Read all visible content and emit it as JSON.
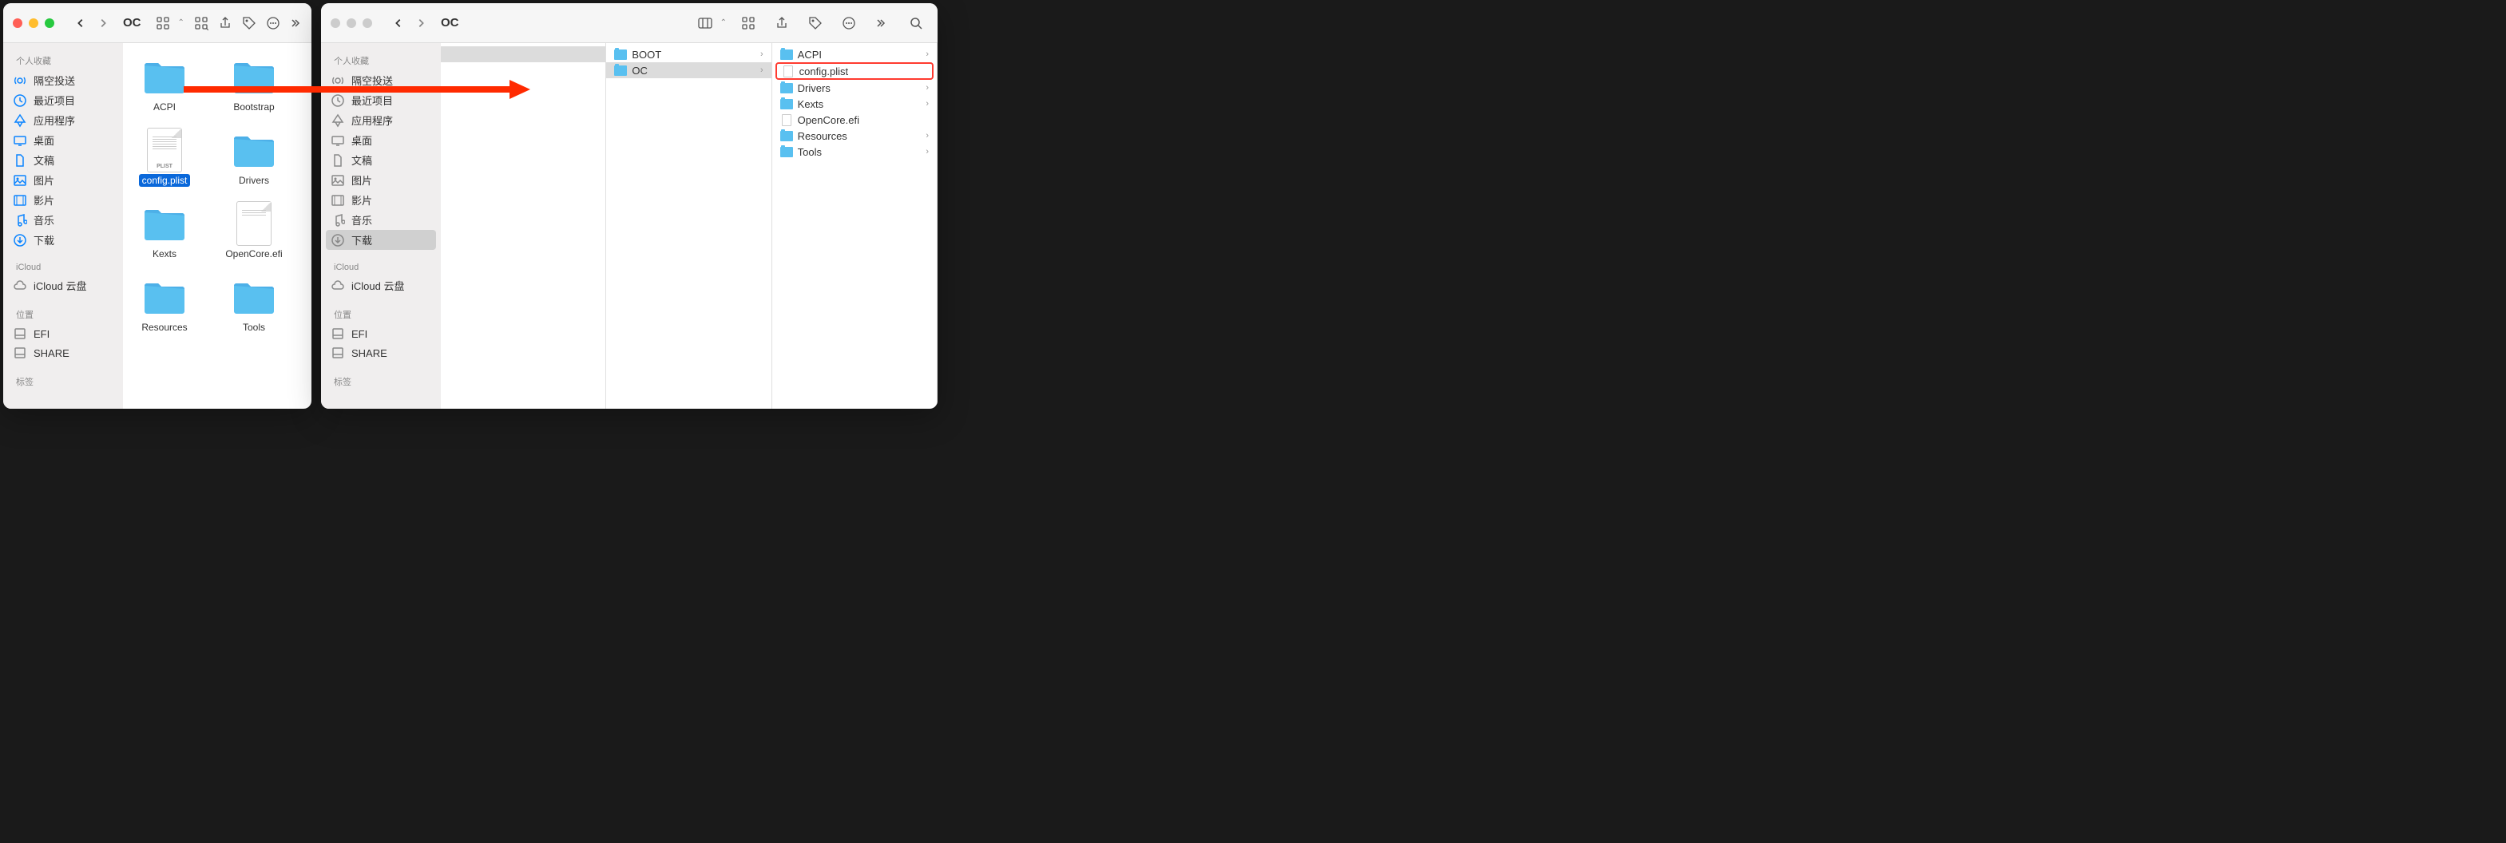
{
  "left_window": {
    "title": "OC",
    "sidebar": {
      "favorites_header": "个人收藏",
      "favorites": [
        {
          "icon": "airdrop",
          "label": "隔空投送"
        },
        {
          "icon": "clock",
          "label": "最近项目"
        },
        {
          "icon": "apps",
          "label": "应用程序"
        },
        {
          "icon": "desktop",
          "label": "桌面"
        },
        {
          "icon": "document",
          "label": "文稿"
        },
        {
          "icon": "image",
          "label": "图片"
        },
        {
          "icon": "movie",
          "label": "影片"
        },
        {
          "icon": "music",
          "label": "音乐"
        },
        {
          "icon": "download",
          "label": "下载"
        }
      ],
      "icloud_header": "iCloud",
      "icloud": [
        {
          "icon": "cloud",
          "label": "iCloud 云盘"
        }
      ],
      "locations_header": "位置",
      "locations": [
        {
          "icon": "disk",
          "label": "EFI"
        },
        {
          "icon": "disk",
          "label": "SHARE"
        }
      ],
      "tags_header": "标签"
    },
    "items": [
      {
        "name": "ACPI",
        "type": "folder"
      },
      {
        "name": "Bootstrap",
        "type": "folder"
      },
      {
        "name": "config.plist",
        "type": "plist",
        "selected": true
      },
      {
        "name": "Drivers",
        "type": "folder"
      },
      {
        "name": "Kexts",
        "type": "folder"
      },
      {
        "name": "OpenCore.efi",
        "type": "file"
      },
      {
        "name": "Resources",
        "type": "folder"
      },
      {
        "name": "Tools",
        "type": "folder"
      }
    ],
    "plist_label": "PLIST"
  },
  "right_window": {
    "title": "OC",
    "sidebar": {
      "favorites_header": "个人收藏",
      "favorites": [
        {
          "icon": "airdrop",
          "label": "隔空投送"
        },
        {
          "icon": "clock",
          "label": "最近项目"
        },
        {
          "icon": "apps",
          "label": "应用程序"
        },
        {
          "icon": "desktop",
          "label": "桌面"
        },
        {
          "icon": "document",
          "label": "文稿"
        },
        {
          "icon": "image",
          "label": "图片"
        },
        {
          "icon": "movie",
          "label": "影片"
        },
        {
          "icon": "music",
          "label": "音乐"
        },
        {
          "icon": "download",
          "label": "下载",
          "selected": true
        }
      ],
      "icloud_header": "iCloud",
      "icloud": [
        {
          "icon": "cloud",
          "label": "iCloud 云盘"
        }
      ],
      "locations_header": "位置",
      "locations": [
        {
          "icon": "disk",
          "label": "EFI"
        },
        {
          "icon": "disk",
          "label": "SHARE"
        }
      ],
      "tags_header": "标签"
    },
    "columns": [
      {
        "items": [
          {
            "name": "",
            "type": "blank",
            "selected": true
          }
        ]
      },
      {
        "items": [
          {
            "name": "BOOT",
            "type": "folder",
            "has_children": true
          },
          {
            "name": "OC",
            "type": "folder",
            "has_children": true,
            "selected": true
          }
        ]
      },
      {
        "items": [
          {
            "name": "ACPI",
            "type": "folder",
            "has_children": true
          },
          {
            "name": "config.plist",
            "type": "plist",
            "highlighted": true
          },
          {
            "name": "Drivers",
            "type": "folder",
            "has_children": true
          },
          {
            "name": "Kexts",
            "type": "folder",
            "has_children": true
          },
          {
            "name": "OpenCore.efi",
            "type": "file"
          },
          {
            "name": "Resources",
            "type": "folder",
            "has_children": true
          },
          {
            "name": "Tools",
            "type": "folder",
            "has_children": true
          }
        ]
      }
    ]
  }
}
